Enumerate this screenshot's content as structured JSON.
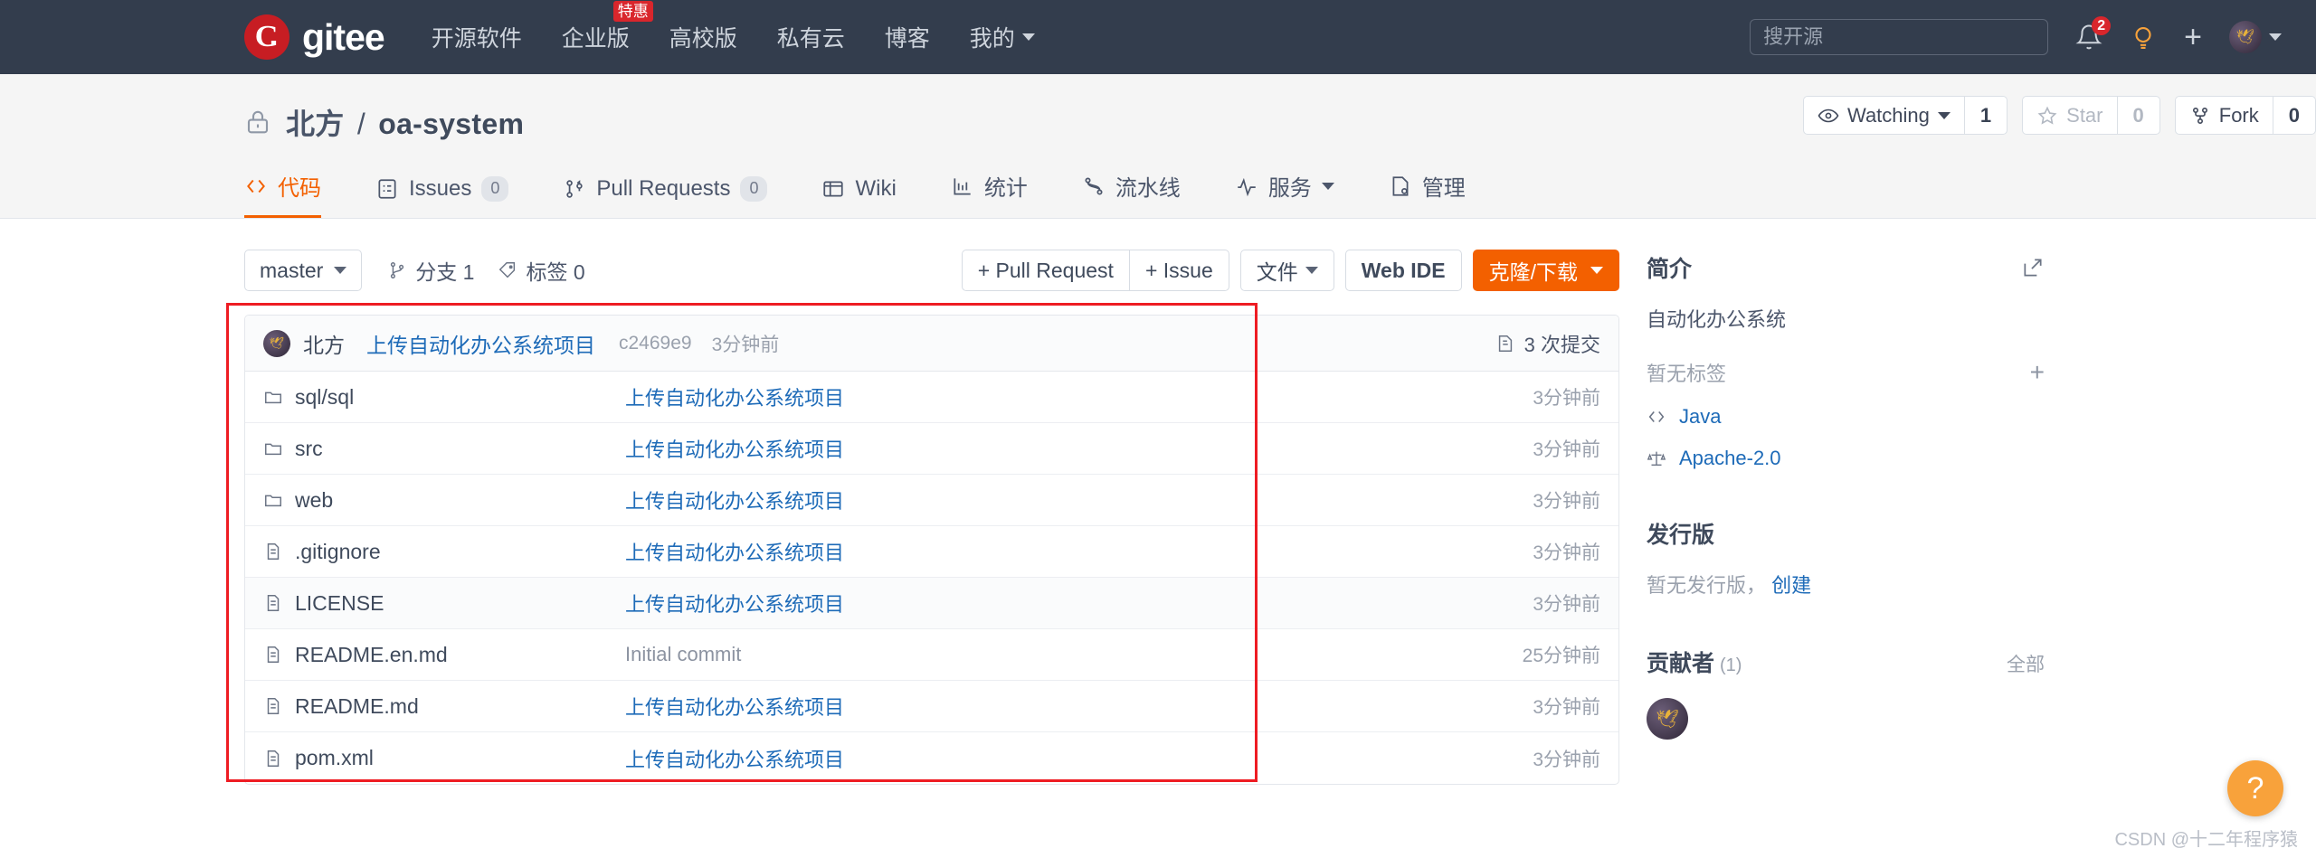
{
  "topnav": {
    "brand": "gitee",
    "items": [
      {
        "label": "开源软件",
        "badge": null,
        "caret": false
      },
      {
        "label": "企业版",
        "badge": "特惠",
        "caret": false
      },
      {
        "label": "高校版",
        "badge": null,
        "caret": false
      },
      {
        "label": "私有云",
        "badge": null,
        "caret": false
      },
      {
        "label": "博客",
        "badge": null,
        "caret": false
      },
      {
        "label": "我的",
        "badge": null,
        "caret": true
      }
    ],
    "search_placeholder": "搜开源",
    "notification_count": "2"
  },
  "repo": {
    "owner": "北方",
    "separator": "/",
    "name": "oa-system",
    "visibility_icon": "lock-icon",
    "actions": {
      "watch_label": "Watching",
      "watch_count": "1",
      "star_label": "Star",
      "star_count": "0",
      "fork_label": "Fork",
      "fork_count": "0"
    }
  },
  "tabs": [
    {
      "label": "代码",
      "icon": "code-icon",
      "count": null,
      "active": true
    },
    {
      "label": "Issues",
      "icon": "issue-icon",
      "count": "0",
      "active": false
    },
    {
      "label": "Pull Requests",
      "icon": "pull-request-icon",
      "count": "0",
      "active": false
    },
    {
      "label": "Wiki",
      "icon": "book-icon",
      "count": null,
      "active": false
    },
    {
      "label": "统计",
      "icon": "chart-icon",
      "count": null,
      "active": false
    },
    {
      "label": "流水线",
      "icon": "pipeline-icon",
      "count": null,
      "active": false
    },
    {
      "label": "服务",
      "icon": "activity-icon",
      "count": null,
      "active": false,
      "caret": true
    },
    {
      "label": "管理",
      "icon": "settings-doc-icon",
      "count": null,
      "active": false
    }
  ],
  "toolbar": {
    "branch": "master",
    "branches_label": "分支 1",
    "tags_label": "标签 0",
    "pull_request_btn": "+ Pull Request",
    "issue_btn": "+ Issue",
    "files_btn": "文件",
    "web_ide_btn": "Web IDE",
    "clone_btn": "克隆/下载"
  },
  "commit_header": {
    "author": "北方",
    "message": "上传自动化办公系统项目",
    "sha": "c2469e9",
    "time": "3分钟前",
    "commits_label": "3 次提交"
  },
  "files": [
    {
      "name": "sql/sql",
      "type": "folder",
      "message": "上传自动化办公系统项目",
      "message_is_link": true,
      "time": "3分钟前"
    },
    {
      "name": "src",
      "type": "folder",
      "message": "上传自动化办公系统项目",
      "message_is_link": true,
      "time": "3分钟前"
    },
    {
      "name": "web",
      "type": "folder",
      "message": "上传自动化办公系统项目",
      "message_is_link": true,
      "time": "3分钟前"
    },
    {
      "name": ".gitignore",
      "type": "file",
      "message": "上传自动化办公系统项目",
      "message_is_link": true,
      "time": "3分钟前"
    },
    {
      "name": "LICENSE",
      "type": "file",
      "message": "上传自动化办公系统项目",
      "message_is_link": true,
      "time": "3分钟前"
    },
    {
      "name": "README.en.md",
      "type": "file",
      "message": "Initial commit",
      "message_is_link": false,
      "time": "25分钟前"
    },
    {
      "name": "README.md",
      "type": "file",
      "message": "上传自动化办公系统项目",
      "message_is_link": true,
      "time": "3分钟前"
    },
    {
      "name": "pom.xml",
      "type": "file",
      "message": "上传自动化办公系统项目",
      "message_is_link": true,
      "time": "3分钟前"
    }
  ],
  "sidebar": {
    "intro_title": "简介",
    "description": "自动化办公系统",
    "tags_empty": "暂无标签",
    "add_tag": "+",
    "language": "Java",
    "license": "Apache-2.0",
    "releases_title": "发行版",
    "releases_empty": "暂无发行版，",
    "releases_create": "创建",
    "contributors_title": "贡献者",
    "contributors_count": "(1)",
    "contributors_all": "全部"
  },
  "misc": {
    "help_fab": "?",
    "watermark": "CSDN @十二年程序猿"
  },
  "colors": {
    "navbar_bg": "#333d4d",
    "accent_orange": "#f36000",
    "link_blue": "#1e6bb8",
    "highlight_red": "#ee1c23",
    "brand_red": "#c71d23"
  }
}
